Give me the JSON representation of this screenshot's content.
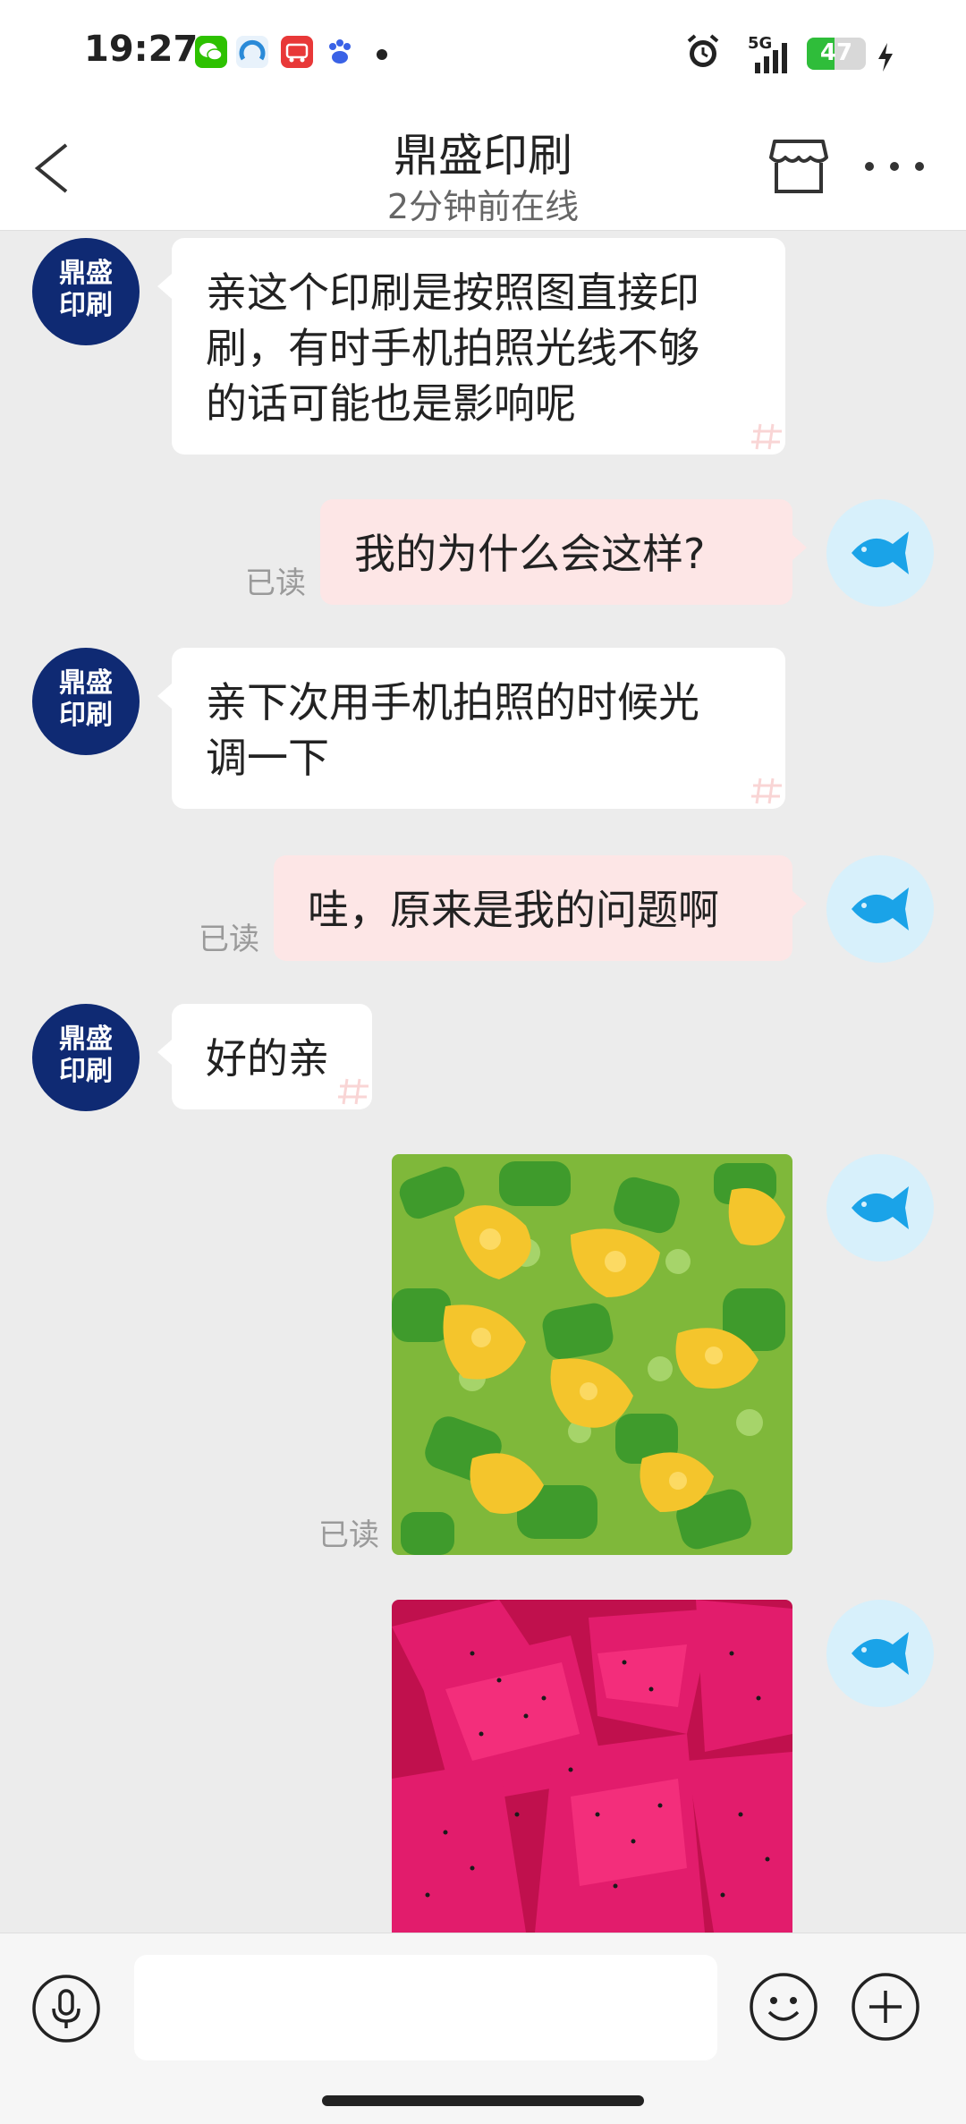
{
  "status_bar": {
    "time": "19:27",
    "network": "5G",
    "battery": "47",
    "icons": [
      "wechat-icon",
      "browser-icon",
      "red-app-icon",
      "baidu-icon",
      "alarm-icon",
      "signal-icon",
      "battery-icon",
      "charging-icon"
    ]
  },
  "header": {
    "title": "鼎盛印刷",
    "subtitle": "2分钟前在线"
  },
  "shop": {
    "avatar_line1": "鼎盛",
    "avatar_line2": "印刷"
  },
  "messages": [
    {
      "from": "shop",
      "text_line1": "亲这个印刷是按照图直接印",
      "text_line2": "刷，有时手机拍照光线不够",
      "text_line3": "的话可能也是影响呢"
    },
    {
      "from": "me",
      "text": "我的为什么会这样?",
      "read": "已读"
    },
    {
      "from": "shop",
      "text_line1": "亲下次用手机拍照的时候光",
      "text_line2": "调一下"
    },
    {
      "from": "me",
      "text": "哇，原来是我的问题啊",
      "read": "已读"
    },
    {
      "from": "shop",
      "text": "好的亲"
    },
    {
      "from": "me",
      "type": "image",
      "read": "已读"
    },
    {
      "from": "me",
      "type": "image"
    }
  ],
  "colors": {
    "shop_avatar": "#0f2a73",
    "outgoing_bubble": "#fde6e6",
    "incoming_bubble": "#ffffff",
    "my_avatar_bg": "#d7f0fb",
    "fish": "#1aa3e8"
  }
}
